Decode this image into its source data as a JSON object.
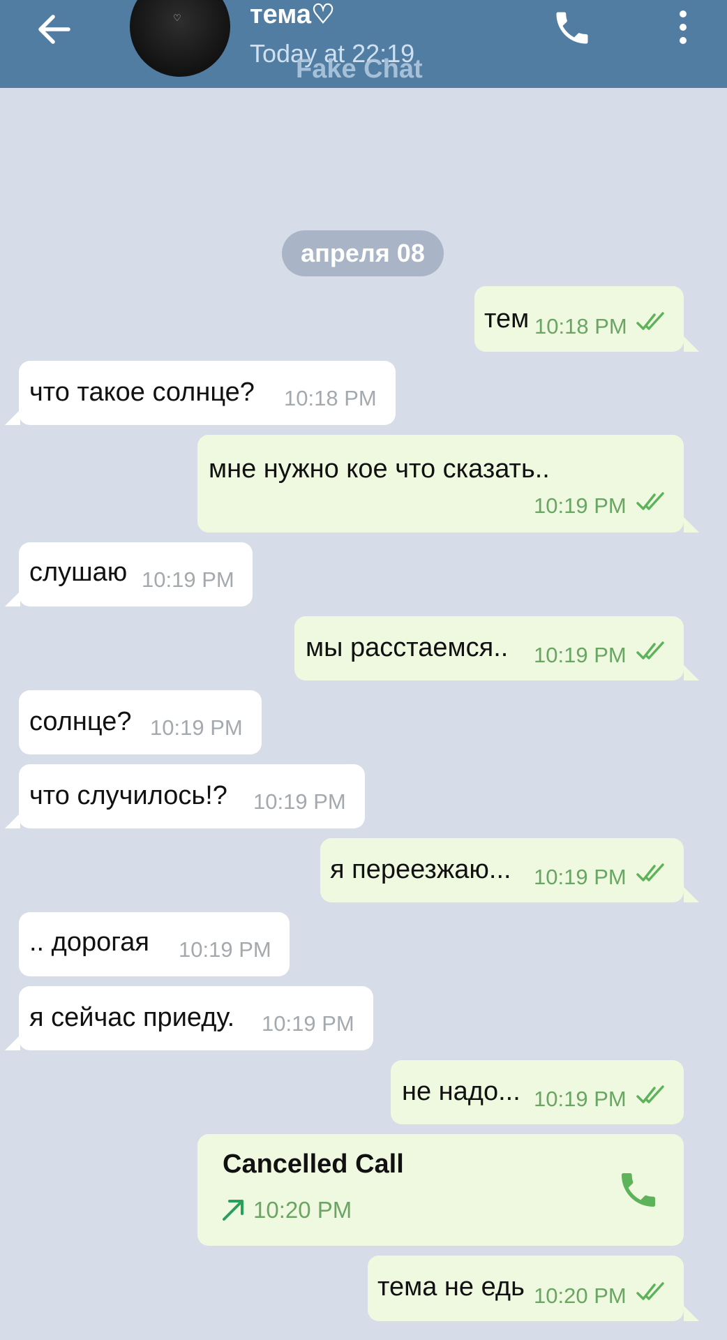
{
  "header": {
    "title": "тема♡",
    "subtitle": "Today at 22:19",
    "watermark": "Fake Chat",
    "colors": {
      "bar": "#517da2",
      "text": "#ffffff"
    },
    "icons": [
      "back-arrow-icon",
      "avatar",
      "phone-icon",
      "more-vertical-icon"
    ]
  },
  "chat": {
    "date_separator": "апреля 08",
    "messages": [
      {
        "dir": "out",
        "text": "тем",
        "time": "10:18 PM"
      },
      {
        "dir": "in",
        "text": "что такое солнце?",
        "time": "10:18 PM"
      },
      {
        "dir": "out",
        "text": "мне нужно кое что сказать..",
        "time": "10:19 PM"
      },
      {
        "dir": "in",
        "text": "слушаю",
        "time": "10:19 PM"
      },
      {
        "dir": "out",
        "text": "мы расстаемся..",
        "time": "10:19 PM"
      },
      {
        "dir": "in",
        "text": "солнце?",
        "time": "10:19 PM"
      },
      {
        "dir": "in",
        "text": "что случилось!?",
        "time": "10:19 PM"
      },
      {
        "dir": "out",
        "text": "я переезжаю...",
        "time": "10:19 PM"
      },
      {
        "dir": "in",
        "text": ".. дорогая",
        "time": "10:19 PM"
      },
      {
        "dir": "in",
        "text": "я сейчас приеду.",
        "time": "10:19 PM"
      },
      {
        "dir": "out",
        "text": "не надо...",
        "time": "10:19 PM"
      },
      {
        "dir": "out",
        "text": "тема не едь",
        "time": "10:20 PM"
      }
    ],
    "call": {
      "title": "Cancelled Call",
      "time": "10:20 PM",
      "icons": [
        "outgoing-arrow-icon",
        "phone-icon"
      ]
    },
    "colors": {
      "background": "#d6dde8",
      "incoming": "#ffffff",
      "outgoing": "#eff9e0",
      "time_out": "#6aa564",
      "time_in": "#a4a9ae"
    }
  }
}
